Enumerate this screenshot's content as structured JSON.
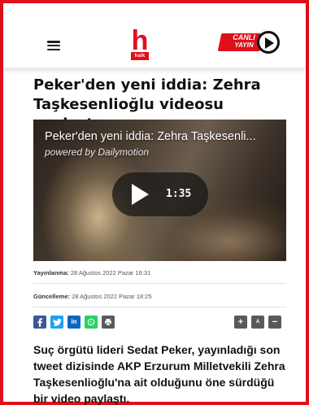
{
  "header": {
    "logo_letter": "h",
    "logo_sub": "halk",
    "live_line1": "CANLI",
    "live_line2": "YAYIN"
  },
  "article": {
    "title": "Peker'den yeni iddia: Zehra Taşkesenlioğlu videosu paylaştı",
    "video": {
      "title": "Peker'den yeni iddia: Zehra Taşkesenli...",
      "powered_by": "powered by Dailymotion",
      "duration": "1:35"
    },
    "published_label": "Yayınlanma:",
    "published_value": "28 Ağustos 2022 Pazar 16:31",
    "updated_label": "Güncelleme:",
    "updated_value": "28 Ağustos 2022 Pazar 18:25",
    "share": [
      {
        "icon": "facebook-icon",
        "glyph": "f",
        "color": "#3b5998"
      },
      {
        "icon": "twitter-icon",
        "glyph": "t",
        "color": "#1da1f2"
      },
      {
        "icon": "linkedin-icon",
        "glyph": "in",
        "color": "#0a66c2"
      },
      {
        "icon": "whatsapp-icon",
        "glyph": "w",
        "color": "#25d366"
      },
      {
        "icon": "print-icon",
        "glyph": "p",
        "color": "#5a5a5a"
      }
    ],
    "text_tools": {
      "increase": "+",
      "font": "A",
      "decrease": "−"
    },
    "lead": "Suç örgütü lideri Sedat Peker, yayınladığı son tweet dizisinde AKP Erzurum Milletvekili Zehra Taşkesenlioğlu'na ait olduğunu öne sürdüğü bir video paylaştı."
  },
  "colors": {
    "accent": "#e0101b"
  }
}
